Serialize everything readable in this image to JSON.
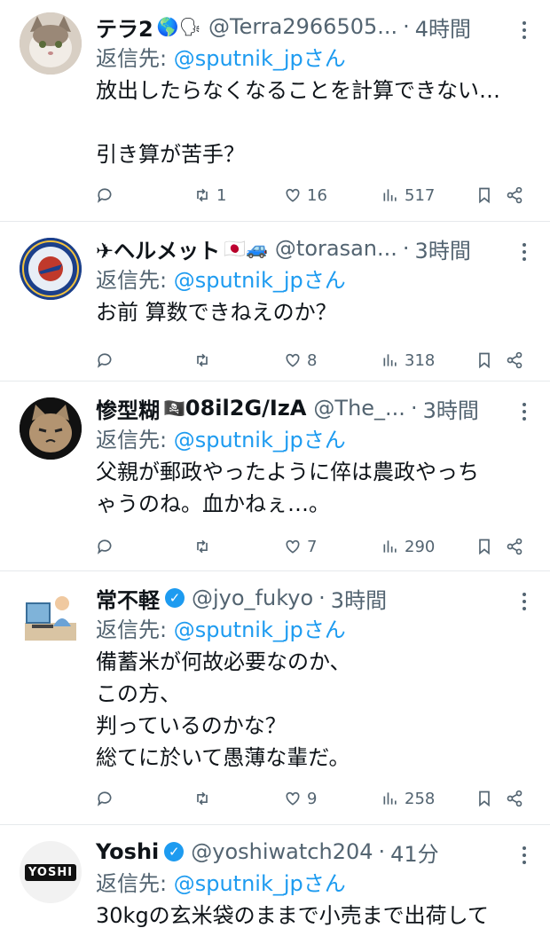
{
  "tweets": [
    {
      "name": "テラ2",
      "emoji": "🌎🗣",
      "handle": "@Terra2966505...",
      "time": "4時間",
      "reply_prefix": "返信先: ",
      "reply_to": "@sputnik_jpさん",
      "text": "放出したらなくなることを計算できない…\n\n引き算が苦手？",
      "retweets": "1",
      "likes": "16",
      "views": "517",
      "avatar_icon": "cat-photo-icon"
    },
    {
      "name": "✈ヘルメット",
      "emoji": "🇯🇵🚙",
      "handle": "@torasan...",
      "time": "3時間",
      "reply_prefix": "返信先: ",
      "reply_to": "@sputnik_jpさん",
      "text": "お前 算数できねえのか？",
      "retweets": "",
      "likes": "8",
      "views": "318",
      "avatar_icon": "flight-group-emblem-icon"
    },
    {
      "name": "惨型糊",
      "emoji": "🏴‍☠️",
      "name_suffix": "08il2G/IzA",
      "handle": "@The_...",
      "time": "3時間",
      "reply_prefix": "返信先: ",
      "reply_to": "@sputnik_jpさん",
      "text": "父親が郵政やったように倅は農政やっち\nゃうのね。血かねぇ…。",
      "retweets": "",
      "likes": "7",
      "views": "290",
      "avatar_icon": "cat-illustration-icon"
    },
    {
      "name": "常不軽",
      "handle": "@jyo_fukyo",
      "time": "3時間",
      "reply_prefix": "返信先: ",
      "reply_to": "@sputnik_jpさん",
      "text": "備蓄米が何故必要なのか、\nこの方、\n判っているのかな？\n総てに於いて愚薄な輩だ。",
      "retweets": "",
      "likes": "9",
      "views": "258",
      "avatar_icon": "person-at-desk-icon"
    },
    {
      "name": "Yoshi",
      "handle": "@yoshiwatch204",
      "time": "41分",
      "reply_prefix": "返信先: ",
      "reply_to": "@sputnik_jpさん",
      "text": "30kgの玄米袋のままで小売まで出荷して",
      "avatar_text": "YOSHI",
      "avatar_icon": "yoshi-logo-icon"
    }
  ],
  "colors": {
    "accent": "#1d9bf0",
    "muted": "#536471",
    "verified": "#1d9bf0"
  }
}
